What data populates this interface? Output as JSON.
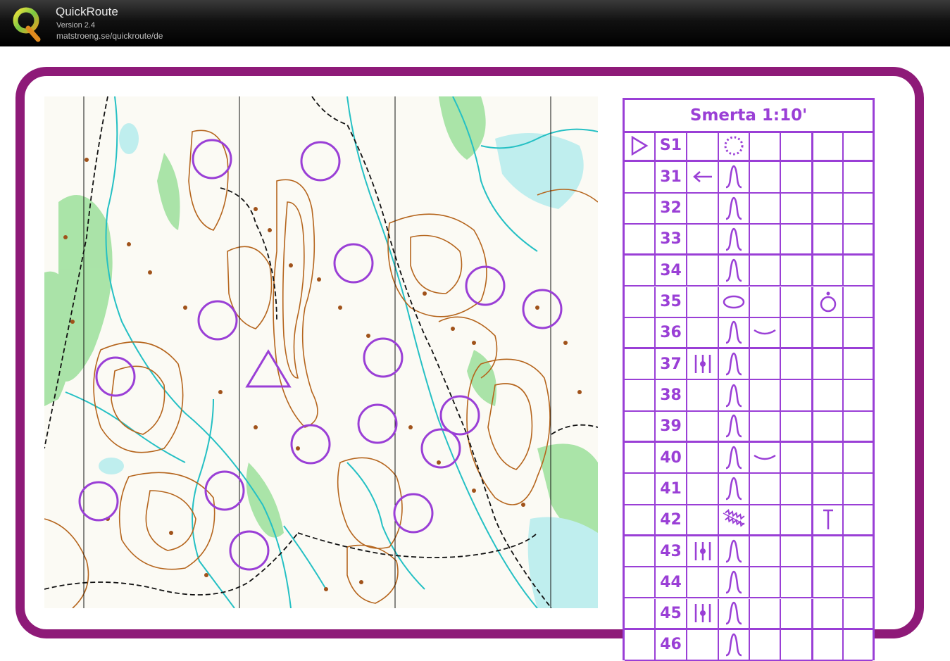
{
  "app": {
    "title": "QuickRoute",
    "version": "Version 2.4",
    "url": "matstroeng.se/quickroute/de"
  },
  "colors": {
    "frame": "#8e1a78",
    "course": "#9a3fd6",
    "contour": "#b5651d",
    "water": "#1fbfbf",
    "vegetation": "#7ed37e"
  },
  "description_card": {
    "title": "Smerta 1:10'",
    "start_label": "S1",
    "rows": [
      {
        "code": "31",
        "direction": "arrow-left-icon",
        "feature": "knoll-icon",
        "detail": "",
        "location": ""
      },
      {
        "code": "32",
        "direction": "",
        "feature": "knoll-icon",
        "detail": "",
        "location": ""
      },
      {
        "code": "33",
        "direction": "",
        "feature": "knoll-icon",
        "detail": "",
        "location": ""
      },
      {
        "code": "34",
        "direction": "",
        "feature": "knoll-icon",
        "detail": "",
        "location": ""
      },
      {
        "code": "35",
        "direction": "",
        "feature": "elongated-knoll-icon",
        "detail": "",
        "location": "top-of-icon"
      },
      {
        "code": "36",
        "direction": "",
        "feature": "knoll-icon",
        "detail": "shallow-icon",
        "location": ""
      },
      {
        "code": "37",
        "direction": "middle-of-three-icon",
        "feature": "knoll-icon",
        "detail": "",
        "location": ""
      },
      {
        "code": "38",
        "direction": "",
        "feature": "knoll-icon",
        "detail": "",
        "location": ""
      },
      {
        "code": "39",
        "direction": "",
        "feature": "knoll-icon",
        "detail": "",
        "location": ""
      },
      {
        "code": "40",
        "direction": "",
        "feature": "knoll-icon",
        "detail": "shallow-icon",
        "location": ""
      },
      {
        "code": "41",
        "direction": "",
        "feature": "knoll-icon",
        "detail": "",
        "location": ""
      },
      {
        "code": "42",
        "direction": "",
        "feature": "rocky-ground-icon",
        "detail": "",
        "location": "foot-icon"
      },
      {
        "code": "43",
        "direction": "middle-of-three-icon",
        "feature": "knoll-icon",
        "detail": "",
        "location": ""
      },
      {
        "code": "44",
        "direction": "",
        "feature": "knoll-icon",
        "detail": "",
        "location": ""
      },
      {
        "code": "45",
        "direction": "middle-of-three-icon",
        "feature": "knoll-icon",
        "detail": "",
        "location": ""
      },
      {
        "code": "46",
        "direction": "",
        "feature": "knoll-icon",
        "detail": "",
        "location": ""
      }
    ]
  }
}
